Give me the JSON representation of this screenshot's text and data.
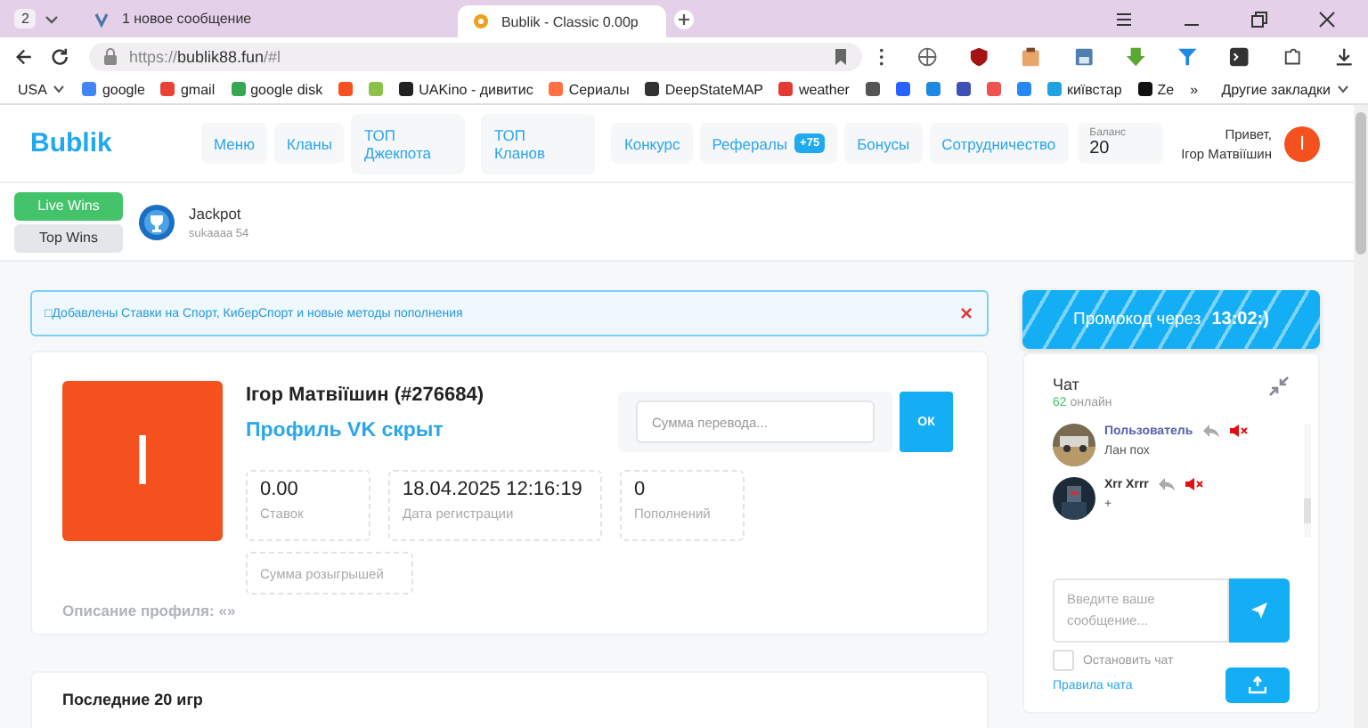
{
  "browser": {
    "tab_count": "2",
    "tabs": [
      {
        "label": "1 новое сообщение",
        "selected": false,
        "kind": "messenger"
      },
      {
        "label": "Bublik - Classic 0.00р",
        "selected": true,
        "kind": "site"
      }
    ],
    "url": {
      "scheme": "https://",
      "host": "bublik88.fun",
      "path": "/#l"
    },
    "bookmarks": [
      {
        "label": "USA",
        "kind": "menu"
      },
      {
        "label": "google",
        "kind": "site",
        "color": "#4285f4"
      },
      {
        "label": "gmail",
        "kind": "site",
        "color": "#ea4335"
      },
      {
        "label": "google disk",
        "kind": "site",
        "color": "#34a853"
      },
      {
        "kind": "site",
        "color": "#f4511e"
      },
      {
        "kind": "site",
        "color": "#8bc34a"
      },
      {
        "label": "UAKino - дивитис",
        "kind": "site",
        "color": "#222222"
      },
      {
        "label": "Сериалы",
        "kind": "site",
        "color": "#ff7043"
      },
      {
        "label": "DeepStateMAP",
        "kind": "site",
        "color": "#333333"
      },
      {
        "label": "weather",
        "kind": "site",
        "color": "#e53935"
      },
      {
        "kind": "site",
        "color": "#555555"
      },
      {
        "kind": "site",
        "color": "#2962ff"
      },
      {
        "kind": "site",
        "color": "#1e88e5"
      },
      {
        "kind": "site",
        "color": "#3f51b5"
      },
      {
        "kind": "site",
        "color": "#ef5350"
      },
      {
        "kind": "site",
        "color": "#2787f5"
      },
      {
        "label": "київстар",
        "kind": "site",
        "color": "#1fa3e0"
      },
      {
        "label": "Ze",
        "kind": "site",
        "color": "#111111"
      },
      {
        "label": "»",
        "kind": "more"
      },
      {
        "label": "Другие закладки",
        "kind": "menu"
      }
    ]
  },
  "header": {
    "logo": "Bublik",
    "nav": [
      {
        "label": "Меню"
      },
      {
        "label": "Кланы"
      },
      {
        "label": "ТОП Джекпота"
      },
      {
        "label": "ТОП Кланов"
      },
      {
        "label": "Конкурс"
      },
      {
        "label": "Рефералы",
        "badge": "+75"
      },
      {
        "label": "Бонусы"
      },
      {
        "label": "Сотрудничество"
      }
    ],
    "balance": {
      "label": "Баланс",
      "value": "20"
    },
    "greeting": "Привет,",
    "user_name": "Ігор Матвіїшин",
    "avatar_letter": "I"
  },
  "wins": {
    "tabs": [
      {
        "label": "Live Wins",
        "selected": true
      },
      {
        "label": "Top Wins",
        "selected": false
      }
    ],
    "items": [
      {
        "title": "Jackpot",
        "subtitle": "sukaaaa 54"
      }
    ]
  },
  "notice": {
    "text": "□Добавлены Ставки на Спорт, КиберСпорт и новые методы пополнения",
    "close": "×"
  },
  "profile": {
    "avatar_letter": "I",
    "name": "Ігор Матвіїшин (#276684)",
    "vk": "Профиль VK скрыт",
    "transfer": {
      "placeholder": "Сумма перевода...",
      "button": "ОК"
    },
    "stats": [
      {
        "value": "0.00",
        "label": "Ставок"
      },
      {
        "value": "18.04.2025 12:16:19",
        "label": "Дата регистрации"
      },
      {
        "value": "0",
        "label": "Пополнений"
      },
      {
        "label": "Сумма розыгрышей"
      }
    ],
    "description": "Описание профиля: «»"
  },
  "games": {
    "title": "Последние 20 игр"
  },
  "promo": {
    "text": "Промокод через",
    "time": "13:02:)"
  },
  "chat": {
    "title": "Чат",
    "online_count": "62",
    "online_label": "онлайн",
    "messages": [
      {
        "author": "Пользователь",
        "color": "#5b5fae",
        "text": "Лан пох"
      },
      {
        "author": "Xrr Xrrr",
        "color": "#333333",
        "text": "+"
      }
    ],
    "placeholder": "Введите ваше сообщение...",
    "stop": {
      "label": "Остановить чат",
      "checked": false
    },
    "rules": "Правила чата"
  }
}
